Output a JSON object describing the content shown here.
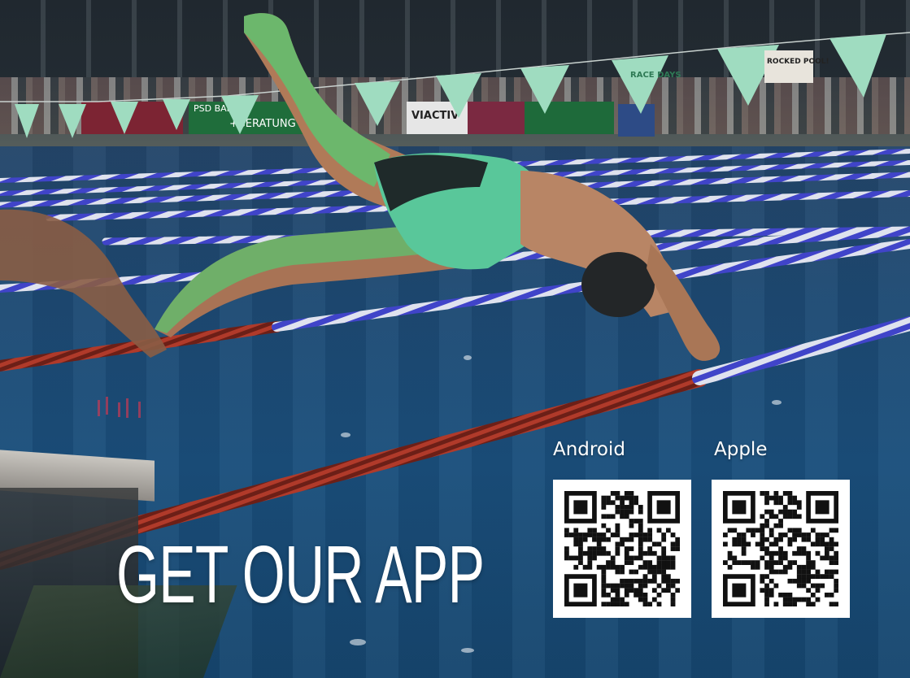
{
  "promo": {
    "headline": "GET OUR APP"
  },
  "downloads": [
    {
      "platform": "Android",
      "qr_seed": 17,
      "qr_icon": "qr-code-icon"
    },
    {
      "platform": "Apple",
      "qr_seed": 53,
      "qr_icon": "qr-code-icon"
    }
  ],
  "background": {
    "description_icon": "swimmer-diving-photo",
    "banner_texts": [
      "PSD BANK",
      "+BERATUNG",
      "VIACTIV",
      "RACE DAYS",
      "ROCKED POOL!"
    ]
  },
  "colors": {
    "headline": "#ffffff",
    "pool_blue": "#1d4a74",
    "bunting_green": "#9fdcc0",
    "lane_red": "#b03a2a",
    "lane_blue": "#3c3ec8",
    "qr_dark": "#111111"
  }
}
